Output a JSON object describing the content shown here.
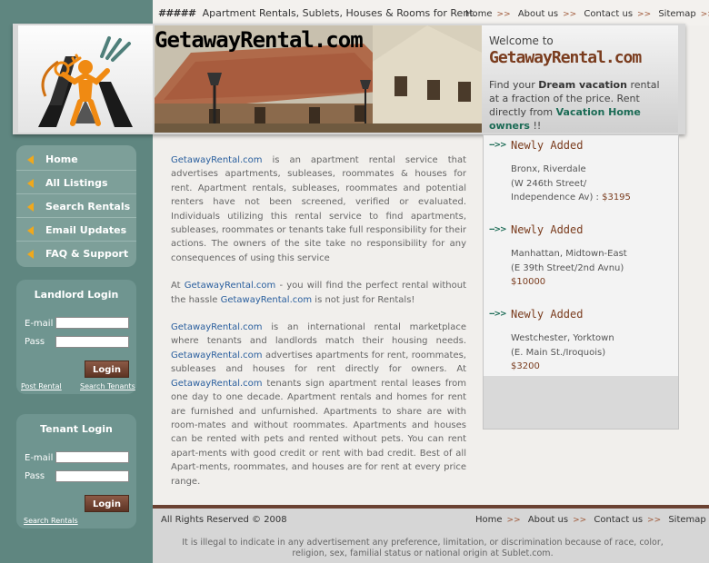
{
  "tagline": {
    "hash": "#####",
    "text": "Apartment Rentals, Sublets, Houses & Rooms for Rent."
  },
  "top_nav": [
    "Home",
    "About us",
    "Contact us",
    "Sitemap"
  ],
  "nav_separator": ">>",
  "brand": "GetawayRental.com",
  "welcome": {
    "line1": "Welcome to",
    "brand": "GetawayRental.com",
    "t1": "Find your ",
    "b1": "Dream vacation",
    "t2": " rental at a fraction of the price. Rent directly from ",
    "b2": "Vacation Home owners",
    "t3": " !!"
  },
  "sidebar_nav": [
    "Home",
    "All Listings",
    "Search Rentals",
    "Email Updates",
    "FAQ & Support"
  ],
  "landlord_login": {
    "title": "Landlord Login",
    "email_label": "E-mail",
    "pass_label": "Pass",
    "button": "Login",
    "link1": "Post Rental",
    "link2": "Search Tenants"
  },
  "tenant_login": {
    "title": "Tenant Login",
    "email_label": "E-mail",
    "pass_label": "Pass",
    "button": "Login",
    "link1": "Search Rentals"
  },
  "main": {
    "p1_link": "GetawayRental.com",
    "p1": " is an apartment rental service that advertises apartments, subleases, roommates & houses for rent. Apartment rentals, subleases, roommates and potential renters have not been screened, verified or evaluated. Individuals utilizing this rental service to find apartments, subleases, roommates or tenants take full responsibility for their actions. The owners of the site take no responsibility for any consequences of using this service",
    "p2_a": "At ",
    "p2_link1": "GetawayRental.com",
    "p2_b": " - you will find the perfect rental without the hassle ",
    "p2_link2": "GetawayRental.com",
    "p2_c": " is not just for Rentals!",
    "p3_link1": "GetawayRental.com",
    "p3_a": " is an international rental marketplace where tenants and landlords match their housing needs. ",
    "p3_link2": "GetawayRental.com",
    "p3_b": " advertises apartments for rent, roommates, subleases and houses for rent directly for owners. At ",
    "p3_link3": "GetawayRental.com",
    "p3_c": " tenants sign apartment rental leases from one day to one decade. Apartment rentals and homes for rent are furnished and unfurnished. Apartments to share are with room-mates and without roommates. Apartments and houses can be rented with pets and rented without pets. You can rent apart-ments with good credit or rent with bad credit. Best of all Apart-ments, roommates, and houses are for rent at every price range."
  },
  "newly_added": {
    "arrow": "-->>",
    "title": "Newly Added",
    "items": [
      {
        "line1": "Bronx, Riverdale",
        "line2": "(W 246th Street/",
        "line3": "Independence Av) : ",
        "price": "$3195"
      },
      {
        "line1": "Manhattan, Midtown-East",
        "line2": "(E 39th Street/2nd Avnu)",
        "price": "$10000"
      },
      {
        "line1": "Westchester, Yorktown",
        "line2": "(E. Main St./Iroquois)",
        "price": "$3200"
      }
    ]
  },
  "footer": {
    "copyright": "All Rights Reserved © 2008",
    "nav": [
      "Home",
      "About us",
      "Contact us",
      "Sitemap"
    ],
    "disclaimer": "It is illegal to indicate in any advertisement any preference, limitation, or discrimination because of race, color, religion, sex, familial status or national origin at Sublet.com."
  }
}
